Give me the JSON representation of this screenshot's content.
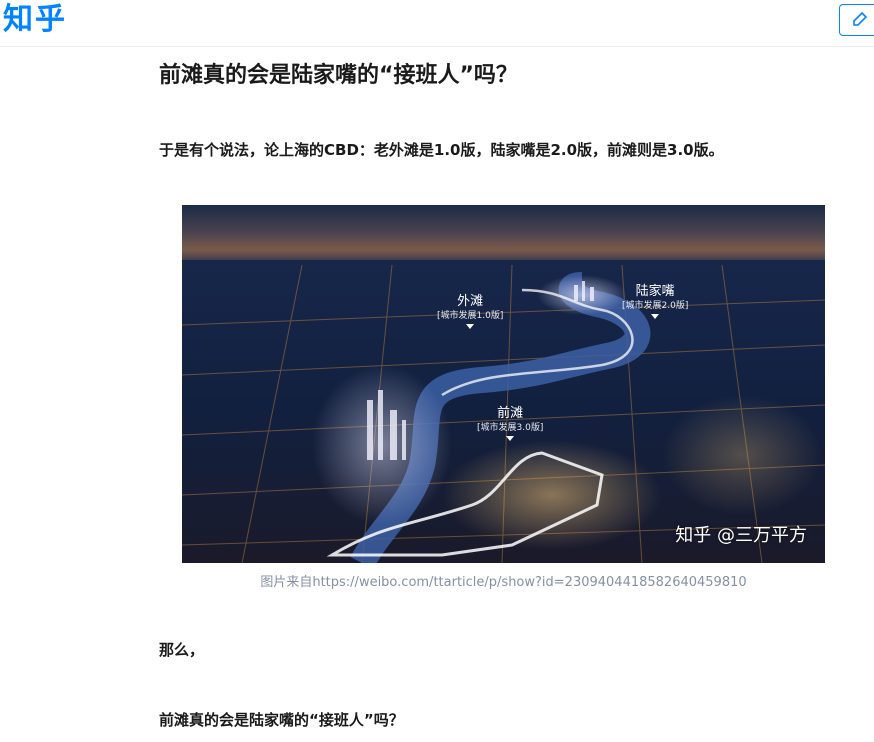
{
  "header": {
    "logo_text": "知乎",
    "write_icon": "edit-icon",
    "brand_color": "#0084ff"
  },
  "article": {
    "title": "前滩真的会是陆家嘴的“接班人”吗？",
    "paragraph1": "于是有个说法，论上海的CBD：老外滩是1.0版，陆家嘴是2.0版，前滩则是3.0版。",
    "image": {
      "labels": [
        {
          "name": "外滩",
          "sub": "[城市发展1.0版]"
        },
        {
          "name": "陆家嘴",
          "sub": "[城市发展2.0版]"
        },
        {
          "name": "前滩",
          "sub": "[城市发展3.0版]"
        }
      ],
      "watermark": "知乎 @三万平方"
    },
    "caption": "图片来自https://weibo.com/ttarticle/p/show?id=2309404418582640459810",
    "paragraph2": "那么，",
    "paragraph3": "前滩真的会是陆家嘴的“接班人”吗？"
  }
}
